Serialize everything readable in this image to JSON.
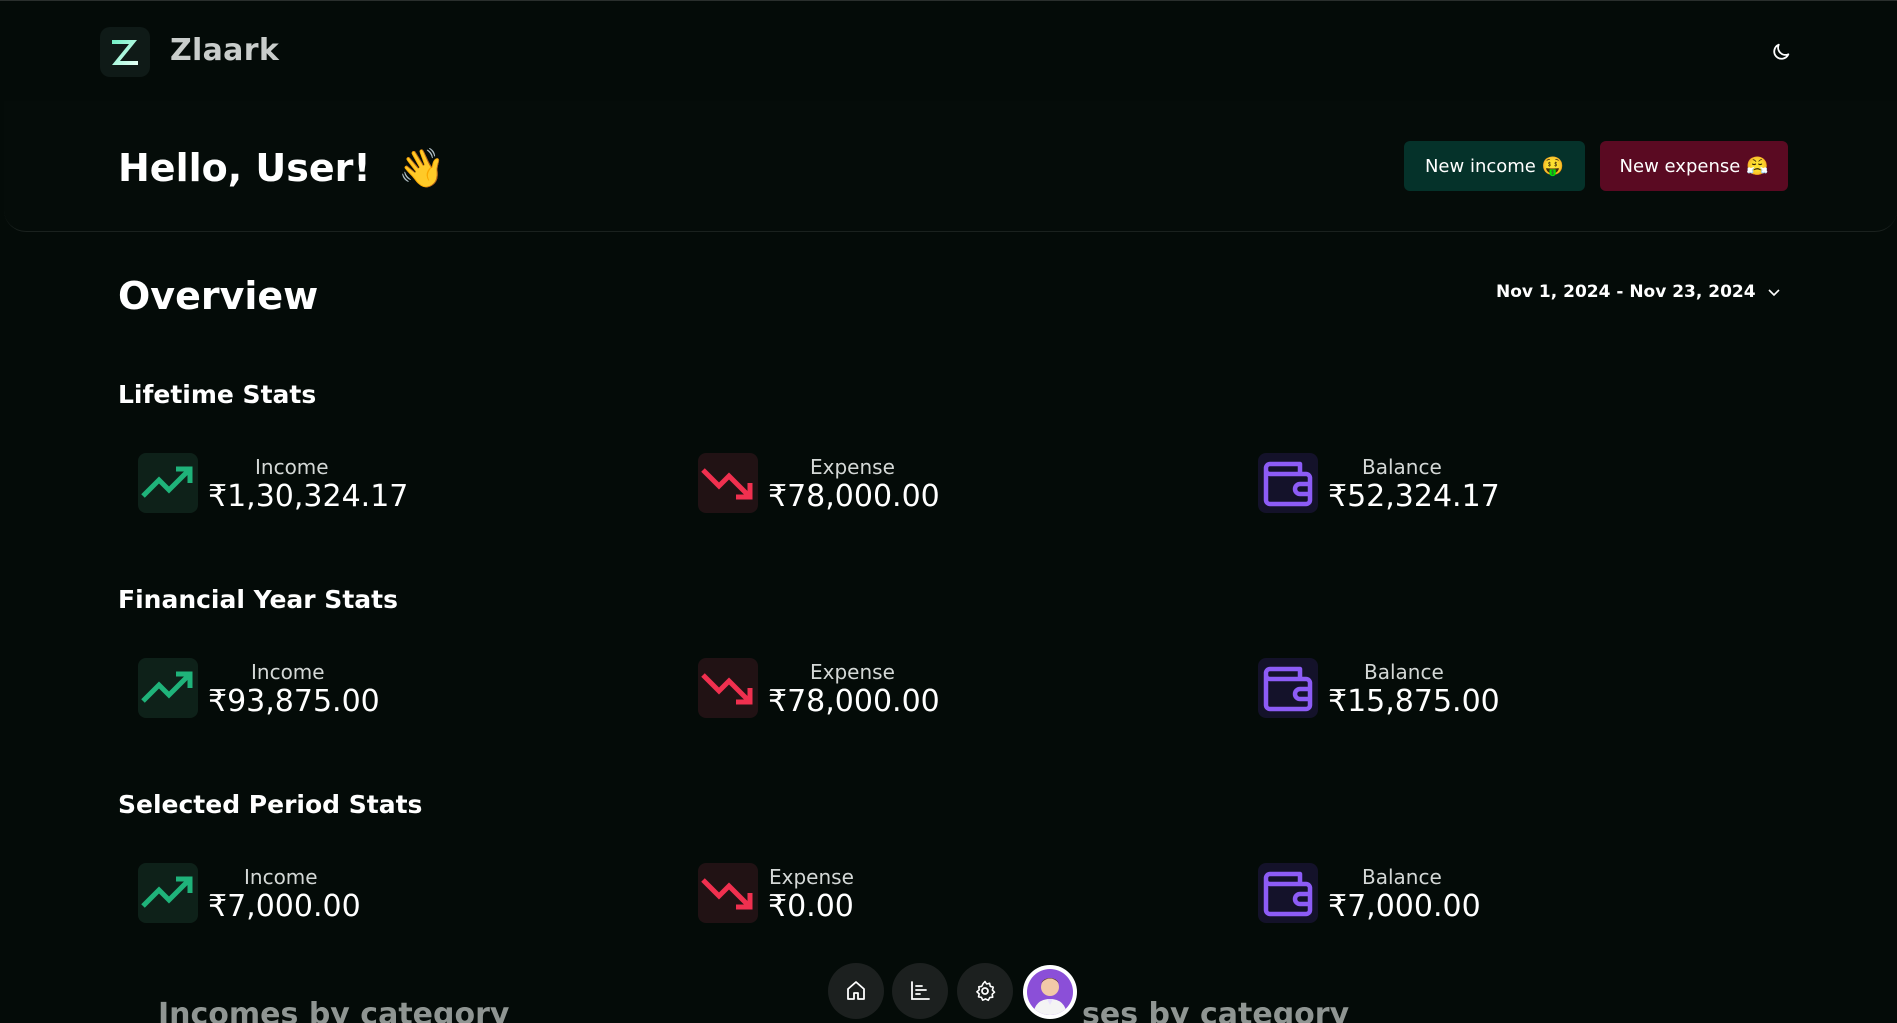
{
  "app": {
    "name": "Zlaark",
    "logo_letter": "Z"
  },
  "header": {
    "greeting": "Hello, User!",
    "greeting_emoji": "👋",
    "new_income_label": "New income 🤑",
    "new_expense_label": "New expense 😤"
  },
  "overview": {
    "title": "Overview",
    "date_range": "Nov 1, 2024 - Nov 23, 2024"
  },
  "sections": {
    "lifetime": {
      "title": "Lifetime Stats",
      "income": {
        "label": "Income",
        "value": "₹1,30,324.17"
      },
      "expense": {
        "label": "Expense",
        "value": "₹78,000.00"
      },
      "balance": {
        "label": "Balance",
        "value": "₹52,324.17"
      }
    },
    "financial_year": {
      "title": "Financial Year Stats",
      "income": {
        "label": "Income",
        "value": "₹93,875.00"
      },
      "expense": {
        "label": "Expense",
        "value": "₹78,000.00"
      },
      "balance": {
        "label": "Balance",
        "value": "₹15,875.00"
      }
    },
    "selected_period": {
      "title": "Selected Period Stats",
      "income": {
        "label": "Income",
        "value": "₹7,000.00"
      },
      "expense": {
        "label": "Expense",
        "value": "₹0.00"
      },
      "balance": {
        "label": "Balance",
        "value": "₹7,000.00"
      }
    }
  },
  "bottom": {
    "incomes_heading": "Incomes by category",
    "expenses_heading_partial": "ses by category"
  },
  "dock": {
    "icons": [
      "home-icon",
      "chart-icon",
      "gear-icon",
      "avatar"
    ]
  },
  "colors": {
    "background": "#040b08",
    "income_green": "#1fb37a",
    "expense_red": "#f0304f",
    "balance_purple": "#8d5cf6",
    "income_button": "#05322a",
    "expense_button": "#5a0a22"
  }
}
